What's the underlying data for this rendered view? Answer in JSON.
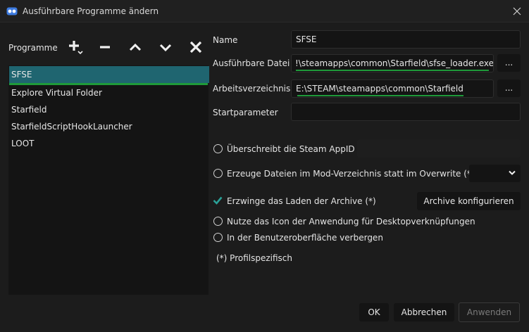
{
  "window": {
    "title": "Ausführbare Programme ändern",
    "app_icon": "mo2-logo-icon",
    "close_icon": "close-icon"
  },
  "sidebar": {
    "label": "Programme",
    "tools": [
      {
        "name": "add-icon"
      },
      {
        "name": "remove-icon"
      },
      {
        "name": "move-up-icon"
      },
      {
        "name": "move-down-icon"
      },
      {
        "name": "delete-icon"
      }
    ],
    "items": [
      {
        "label": "SFSE",
        "selected": true
      },
      {
        "label": "Explore Virtual Folder",
        "selected": false
      },
      {
        "label": "Starfield",
        "selected": false
      },
      {
        "label": "StarfieldScriptHookLauncher",
        "selected": false
      },
      {
        "label": "LOOT",
        "selected": false
      }
    ]
  },
  "form": {
    "name_label": "Name",
    "name_value": "SFSE",
    "exe_label": "Ausführbare Datei",
    "exe_value": "!\\steamapps\\common\\Starfield\\sfse_loader.exe",
    "exe_browse": "...",
    "workdir_label": "Arbeitsverzeichnis",
    "workdir_value": "E:\\STEAM\\steamapps\\common\\Starfield",
    "workdir_browse": "...",
    "args_label": "Startparameter",
    "args_value": ""
  },
  "options": {
    "override_appid_label": "Überschreibt die Steam AppID",
    "override_appid_value": "",
    "create_files_label": "Erzeuge Dateien im Mod-Verzeichnis statt im Overwrite (*)",
    "force_archives_label": "Erzwinge das Laden der Archive (*)",
    "configure_archives_button": "Archive konfigurieren",
    "use_icon_label": "Nutze das Icon der Anwendung für Desktopverknüpfungen",
    "hide_ui_label": "In der Benutzeroberfläche verbergen",
    "profile_note": "(*) Profilspezifisch"
  },
  "footer": {
    "ok": "OK",
    "cancel": "Abbrechen",
    "apply": "Anwenden"
  },
  "colors": {
    "accent_selected": "#1f6570",
    "highlight_green": "#1f9a3a",
    "check_teal": "#2aa198"
  }
}
